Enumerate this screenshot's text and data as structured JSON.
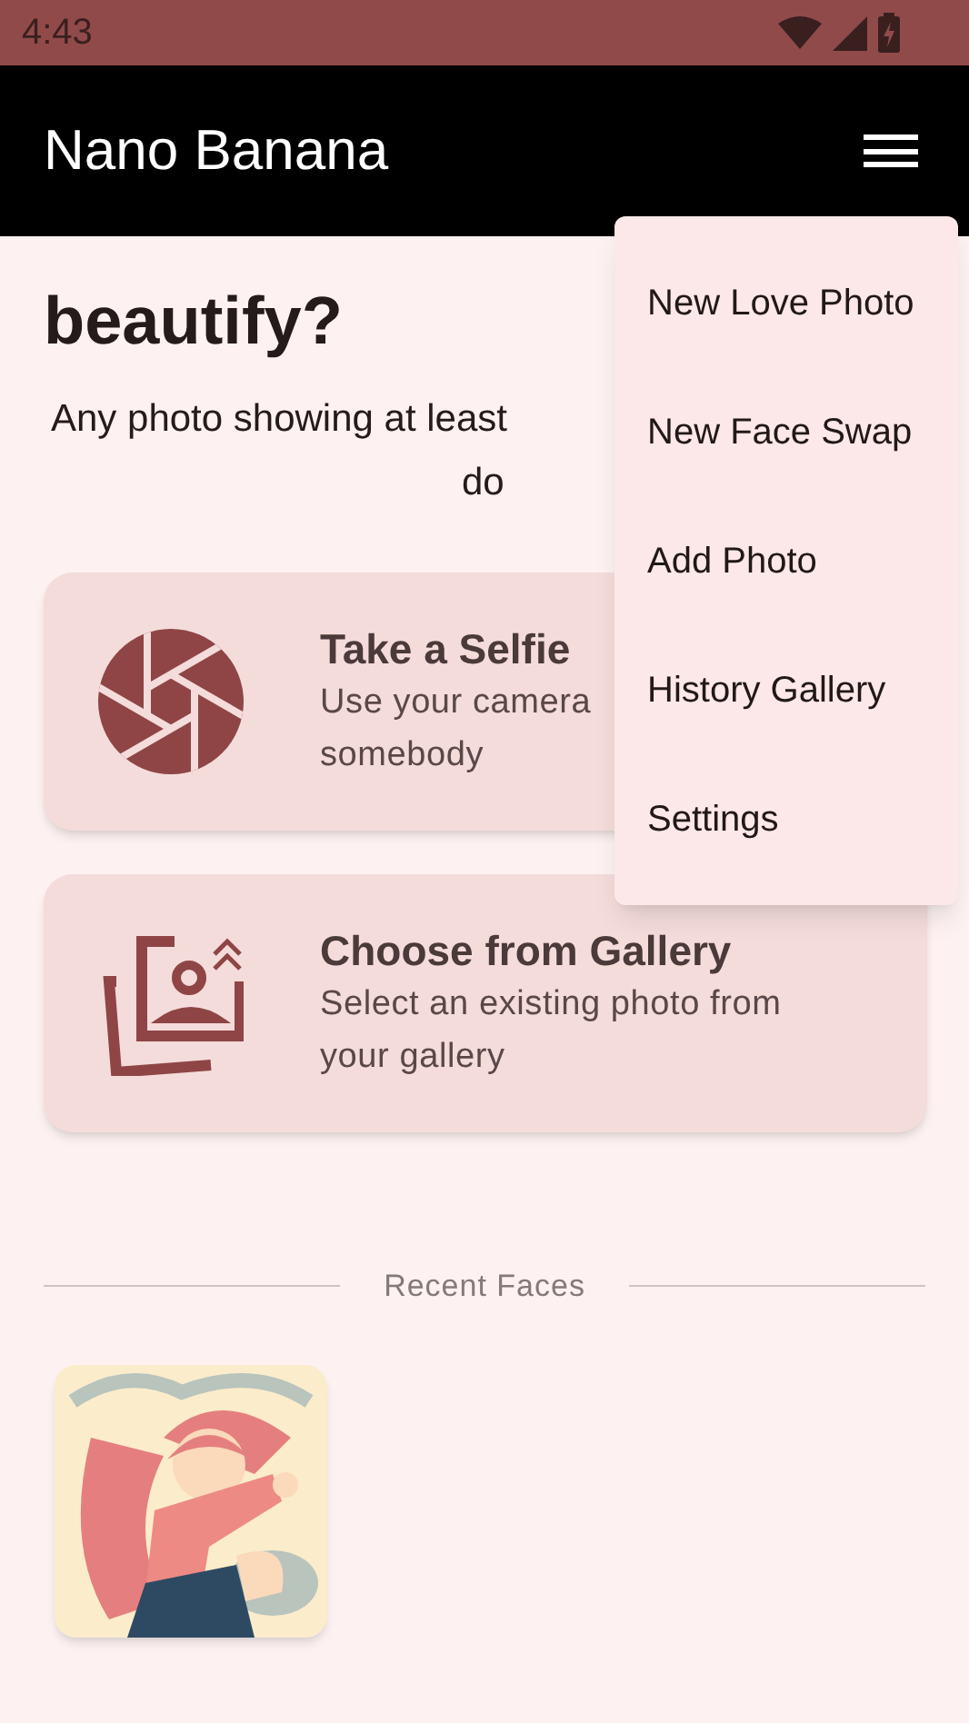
{
  "status_bar": {
    "time": "4:43"
  },
  "app_bar": {
    "title": "Nano Banana"
  },
  "heading": {
    "lines": [
      "beautify?"
    ]
  },
  "subtitle": {
    "lines": [
      "Any photo showing at least",
      "do"
    ]
  },
  "cards": [
    {
      "kind": "camera",
      "title": "Take a Selfie",
      "description_lines": [
        "Use your camera",
        "somebody"
      ]
    },
    {
      "kind": "gallery",
      "title": "Choose from Gallery",
      "description_lines": [
        "Select an existing photo from",
        "your gallery"
      ]
    }
  ],
  "recent_faces": {
    "label": "Recent Faces"
  },
  "menu": {
    "open": true,
    "items": [
      "New Love Photo",
      "New Face Swap",
      "Add Photo",
      "History Gallery",
      "Settings"
    ]
  }
}
